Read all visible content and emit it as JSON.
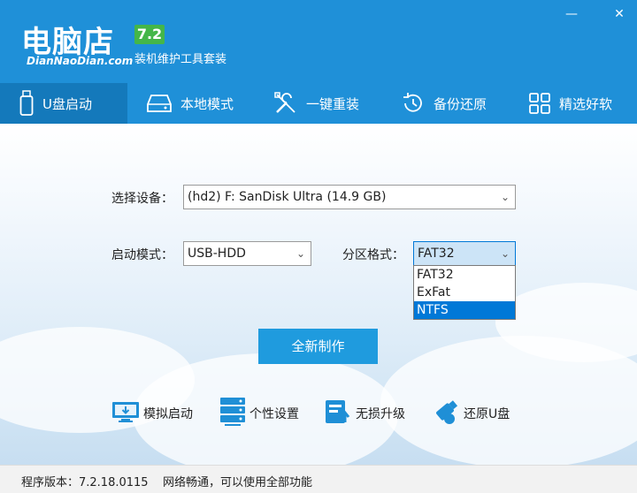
{
  "header": {
    "logo": "电脑店",
    "logo_url": "DianNaoDian.com",
    "version_badge": "7.2",
    "subtitle": "装机维护工具套装"
  },
  "window": {
    "minimize": "—",
    "close": "✕"
  },
  "nav": [
    {
      "label": "U盘启动",
      "icon": "usb-drive-icon",
      "active": true
    },
    {
      "label": "本地模式",
      "icon": "hard-disk-icon",
      "active": false
    },
    {
      "label": "一键重装",
      "icon": "tools-icon",
      "active": false
    },
    {
      "label": "备份还原",
      "icon": "restore-clock-icon",
      "active": false
    },
    {
      "label": "精选好软",
      "icon": "app-grid-icon",
      "active": false
    }
  ],
  "form": {
    "device_label": "选择设备：",
    "device_value": "(hd2) F: SanDisk Ultra (14.9 GB)",
    "boot_mode_label": "启动模式：",
    "boot_mode_value": "USB-HDD",
    "partition_label": "分区格式：",
    "partition_value": "FAT32",
    "partition_options": [
      "FAT32",
      "ExFat",
      "NTFS"
    ],
    "partition_highlighted": "NTFS"
  },
  "primary_button": "全新制作",
  "tools": [
    {
      "label": "模拟启动",
      "icon": "monitor-simulate-icon"
    },
    {
      "label": "个性设置",
      "icon": "server-settings-icon"
    },
    {
      "label": "无损升级",
      "icon": "upgrade-icon"
    },
    {
      "label": "还原U盘",
      "icon": "usb-restore-icon"
    }
  ],
  "status": {
    "version": "程序版本：7.2.18.0115",
    "network": "网络畅通，可以使用全部功能"
  },
  "colors": {
    "header_bg": "#1f90d8",
    "nav_active": "#1479bb",
    "badge": "#44b649",
    "button": "#1f9bde"
  }
}
